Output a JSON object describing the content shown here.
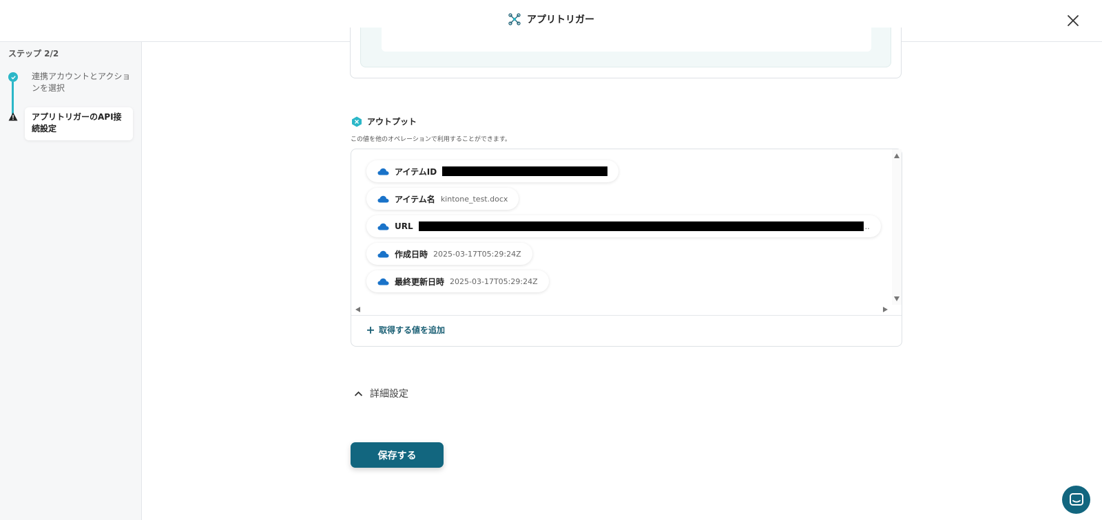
{
  "header": {
    "title": "アプリトリガー"
  },
  "sidebar": {
    "step_count": "ステップ 2/2",
    "steps": [
      {
        "label": "連携アカウントとアクションを選択",
        "status": "done"
      },
      {
        "label": "アプリトリガーのAPI接続設定",
        "status": "warning"
      }
    ]
  },
  "output": {
    "heading": "アウトプット",
    "subtitle": "この値を他のオペレーションで利用することができます。",
    "items": [
      {
        "label": "アイテムID",
        "value": "",
        "redacted": true
      },
      {
        "label": "アイテム名",
        "value": "kintone_test.docx",
        "redacted": false
      },
      {
        "label": "URL",
        "value": "",
        "redacted": true,
        "truncated": ".."
      },
      {
        "label": "作成日時",
        "value": "2025-03-17T05:29:24Z",
        "redacted": false
      },
      {
        "label": "最終更新日時",
        "value": "2025-03-17T05:29:24Z",
        "redacted": false
      }
    ],
    "add_label": "取得する値を追加"
  },
  "detail": {
    "label": "詳細設定"
  },
  "save": {
    "label": "保存する"
  },
  "colors": {
    "accent": "#12667f",
    "teal": "#2bb7c8",
    "onedrive": "#1a73c9"
  }
}
